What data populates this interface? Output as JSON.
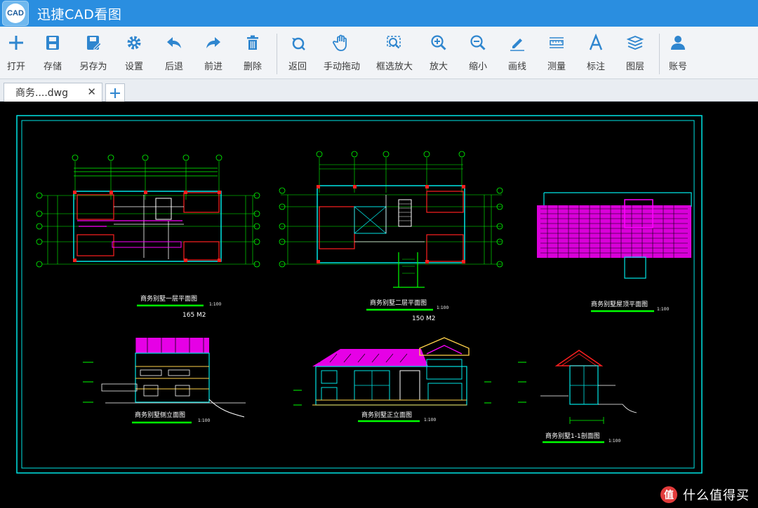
{
  "app": {
    "logo_text": "CAD",
    "title": "迅捷CAD看图"
  },
  "toolbar": {
    "open": "打开",
    "save": "存储",
    "save_as": "另存为",
    "settings": "设置",
    "undo": "后退",
    "redo": "前进",
    "delete": "删除",
    "back": "返回",
    "pan": "手动拖动",
    "zoom_window": "框选放大",
    "zoom_in": "放大",
    "zoom_out": "缩小",
    "draw_line": "画线",
    "measure": "测量",
    "annotate": "标注",
    "layers": "图层",
    "account": "账号"
  },
  "tabs": {
    "active_label": "商务....dwg",
    "close": "✕",
    "add": "+"
  },
  "drawing": {
    "plan1_title": "商务别墅一层平面图",
    "plan1_scale": "1:100",
    "plan1_area": "165 M2",
    "plan2_title": "商务别墅二层平面图",
    "plan2_scale": "1:100",
    "plan2_area": "150 M2",
    "roof_title": "商务别墅屋顶平面图",
    "roof_scale": "1:100",
    "side_title": "商务别墅侧立面图",
    "side_scale": "1:100",
    "front_title": "商务别墅正立面图",
    "front_scale": "1:100",
    "section_title": "商务别墅1-1剖面图",
    "section_scale": "1:100"
  },
  "watermark": {
    "icon": "值",
    "text": "什么值得买"
  },
  "colors": {
    "titlebar": "#2a8ee0",
    "icon_blue": "#2f86cf",
    "cad_cyan": "#00e5e5",
    "cad_magenta": "#ff00ff",
    "cad_green": "#00ff00",
    "cad_red": "#ff2020"
  }
}
